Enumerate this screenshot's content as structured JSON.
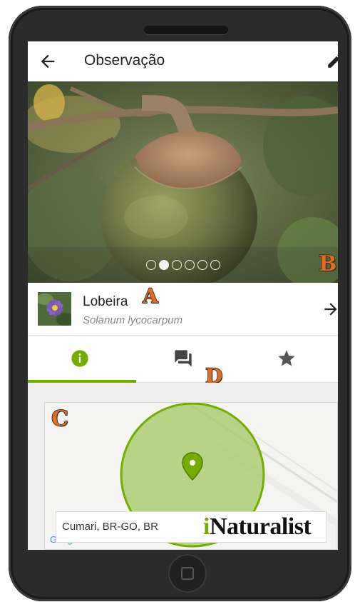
{
  "appbar": {
    "title": "Observação",
    "back_icon": "arrow-left-icon",
    "edit_icon": "pencil-icon"
  },
  "photo": {
    "page_count": 6,
    "active_page": 2
  },
  "taxon": {
    "common_name": "Lobeira",
    "scientific_name": "Solanum lycocarpum"
  },
  "tabs": [
    {
      "name": "info",
      "icon": "info-icon",
      "active": true
    },
    {
      "name": "activity",
      "icon": "chat-icon",
      "active": false
    },
    {
      "name": "favorites",
      "icon": "star-icon",
      "active": false
    }
  ],
  "map": {
    "location": "Cumari, BR-GO, BR",
    "attribution": "Google",
    "brand_prefix": "i",
    "brand_rest": "Naturalist"
  },
  "markers": {
    "a": "A",
    "b": "B",
    "c": "C",
    "d": "D"
  },
  "colors": {
    "accent": "#74ac00",
    "marker": "#e06b22"
  }
}
